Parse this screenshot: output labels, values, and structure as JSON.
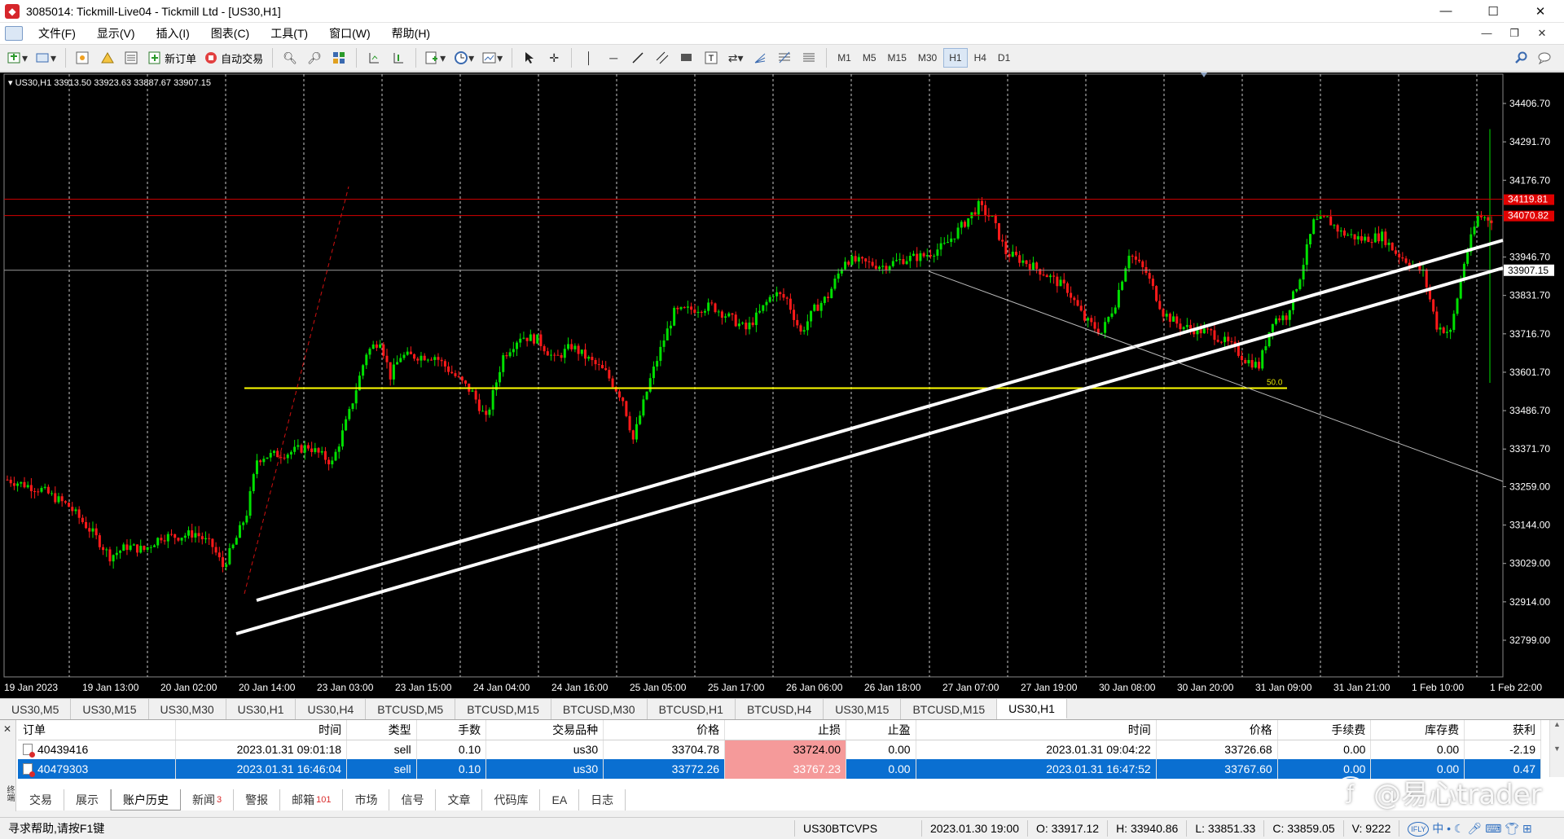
{
  "window": {
    "title": "3085014: Tickmill-Live04 - Tickmill Ltd - [US30,H1]",
    "controls": [
      "—",
      "☐",
      "✕"
    ]
  },
  "menu": {
    "items": [
      "文件(F)",
      "显示(V)",
      "插入(I)",
      "图表(C)",
      "工具(T)",
      "窗口(W)",
      "帮助(H)"
    ],
    "mdi_controls": [
      "—",
      "❐",
      "✕"
    ]
  },
  "toolbar": {
    "new_order_label": "新订单",
    "auto_trading_label": "自动交易",
    "timeframes": [
      "M1",
      "M5",
      "M15",
      "M30",
      "H1",
      "H4",
      "D1"
    ],
    "active_timeframe": "H1"
  },
  "chart": {
    "info": "US30,H1  33913.50 33923.63 33887.67 33907.15",
    "price_axis": [
      "34406.70",
      "34291.70",
      "34176.70",
      "33946.70",
      "33831.70",
      "33716.70",
      "33601.70",
      "33486.70",
      "33371.70",
      "33259.00",
      "33144.00",
      "33029.00",
      "32914.00",
      "32799.00"
    ],
    "price_ticks": [
      34406.7,
      34291.7,
      34176.7,
      33946.7,
      33831.7,
      33716.7,
      33601.7,
      33486.7,
      33371.7,
      33259.0,
      33144.0,
      33029.0,
      32914.0,
      32799.0
    ],
    "red_labels": [
      "34119.81",
      "34070.82"
    ],
    "red_levels": [
      34119.81,
      34070.82
    ],
    "current_price_label": "33907.15",
    "current_price": 33907.15,
    "yellow_level": 33554,
    "fib_label": "50.0",
    "time_axis": [
      "19 Jan 2023",
      "19 Jan 13:00",
      "20 Jan 02:00",
      "20 Jan 14:00",
      "23 Jan 03:00",
      "23 Jan 15:00",
      "24 Jan 04:00",
      "24 Jan 16:00",
      "25 Jan 05:00",
      "25 Jan 17:00",
      "26 Jan 06:00",
      "26 Jan 18:00",
      "27 Jan 07:00",
      "27 Jan 19:00",
      "30 Jan 08:00",
      "30 Jan 20:00",
      "31 Jan 09:00",
      "31 Jan 21:00",
      "1 Feb 10:00",
      "1 Feb 22:00"
    ],
    "colors": {
      "bull": "#00e000",
      "bear": "#ff1a1a",
      "grid": "#c8c8c8",
      "yellow": "#ffff00",
      "red_line": "#d40000",
      "white_line": "#ffffff"
    }
  },
  "symbol_tabs": {
    "tabs": [
      "US30,M5",
      "US30,M15",
      "US30,M30",
      "US30,H1",
      "US30,H4",
      "BTCUSD,M5",
      "BTCUSD,M15",
      "BTCUSD,M30",
      "BTCUSD,H1",
      "BTCUSD,H4",
      "US30,M15",
      "BTCUSD,M15",
      "US30,H1"
    ],
    "active_index": 12
  },
  "orders": {
    "columns": [
      "订单",
      "时间",
      "类型",
      "手数",
      "交易品种",
      "价格",
      "止损",
      "止盈",
      "时间",
      "价格",
      "手续费",
      "库存费",
      "获利"
    ],
    "rows": [
      [
        "40439416",
        "2023.01.31 09:01:18",
        "sell",
        "0.10",
        "us30",
        "33704.78",
        "33724.00",
        "0.00",
        "2023.01.31 09:04:22",
        "33726.68",
        "0.00",
        "0.00",
        "-2.19"
      ],
      [
        "40479303",
        "2023.01.31 16:46:04",
        "sell",
        "0.10",
        "us30",
        "33772.26",
        "33767.23",
        "0.00",
        "2023.01.31 16:47:52",
        "33767.60",
        "0.00",
        "0.00",
        "0.47"
      ]
    ],
    "selected_row": 1
  },
  "terminal": {
    "side_label": "终端",
    "tabs": [
      "交易",
      "展示",
      "账户历史",
      "新闻",
      "警报",
      "邮箱",
      "市场",
      "信号",
      "文章",
      "代码库",
      "EA",
      "日志"
    ],
    "tab_counts": {
      "新闻": "3",
      "邮箱": "101"
    },
    "active_tab": "账户历史"
  },
  "status": {
    "help": "寻求帮助,请按F1键",
    "profile": "US30BTCVPS",
    "datetime": "2023.01.30 19:00",
    "open": "O: 33917.12",
    "high": "H: 33940.86",
    "low": "L: 33851.33",
    "close": "C: 33859.05",
    "volume": "V: 9222"
  },
  "watermark": "@易心trader"
}
